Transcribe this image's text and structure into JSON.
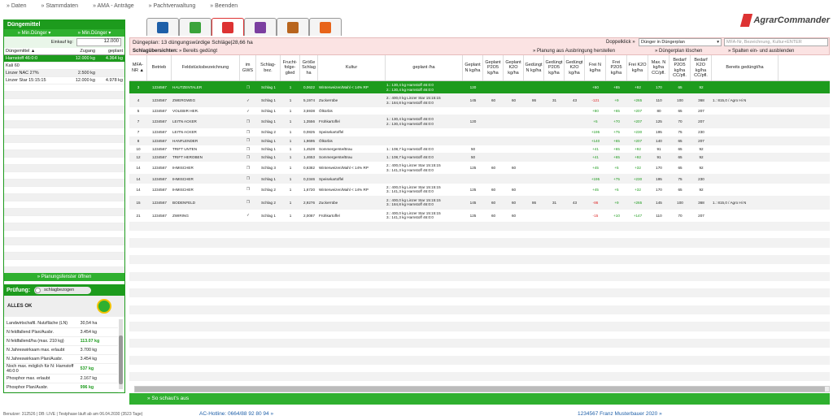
{
  "nav": [
    "» Daten",
    "» Stammdaten",
    "» AMA - Anträge",
    "» Pachtverwaltung",
    "» Beenden"
  ],
  "logo": "AgrarCommander",
  "left": {
    "title": "Düngemittel",
    "btn1": "» Min.Dünger ▾",
    "btn2": "» Min.Dünger ▾",
    "einkauf_label": "Einkauf kg:",
    "einkauf_value": "12.000",
    "cols": [
      "Düngemittel ▲",
      "Zugang",
      "geplant"
    ],
    "rows": [
      [
        "Harnstoff 46:0:0",
        "12.000 kg",
        "4.364 kg"
      ],
      [
        "Kali 60",
        "",
        ""
      ],
      [
        "Linzer NAC 27%",
        "2.500 kg",
        ""
      ],
      [
        "Linzer Star 15:15:15",
        "12.000 kg",
        "4.978 kg"
      ]
    ],
    "plan_btn": "» Planungsfenster öffnen",
    "pruef_label": "Prüfung:",
    "pruef_toggle": "schlagbezogen",
    "status": "ALLES OK",
    "checks": [
      [
        "Landwirtschaftl. Nutzfläche (LN)",
        "30,54 ha",
        ""
      ],
      [
        "N feldfallend Plan/Ausbr.",
        "3.454 kg",
        ""
      ],
      [
        "N feldfallend/ha (max. 210 kg)",
        "113.07 kg",
        "g"
      ],
      [
        "N Jahreswirksam max. erlaubt",
        "3.700 kg",
        ""
      ],
      [
        "N Jahreswirksam Plan/Ausbr.",
        "3.454 kg",
        ""
      ],
      [
        "Noch max. möglich für N: Harnstoff 46:0:0",
        "537 kg",
        "g"
      ],
      [
        "Phosphor max. erlaubt",
        "2.167 kg",
        ""
      ],
      [
        "Phosphor Plan/Ausbr.",
        "996 kg",
        "g"
      ]
    ]
  },
  "main": {
    "plan_title": "Düngeplan: 13 düngungswürdige Schläge|28,66 ha",
    "dbl_label": "Doppelklick »",
    "dbl_value": "Dünger in Düngerplan",
    "search_placeholder": "MFA-Nr, Bezeichnung, Kultur+ENTER",
    "schlag_label": "Schlagübersichten:",
    "bereits_btn": "» Bereits gedüngt",
    "planung_btn": "» Planung aus Ausbringung herstellen",
    "loeschen_btn": "» Düngerplan löschen",
    "spalten_btn": "» Spalten ein- und ausblenden",
    "so_btn": "» So schaut's aus"
  },
  "columns": [
    "MFA-NR ▲",
    "Betrieb",
    "Feldstücksbezeichnung",
    "im GWS",
    "Schlag-bez.",
    "Frucht-folge-glied",
    "Größe Schlag ha",
    "Kultur",
    "geplant /ha",
    "Geplant N kg/ha",
    "Geplant P2O5 kg/ha",
    "Geplant K2O kg/ha",
    "Gedüngt N kg/ha",
    "Gedüngt P2O5 kg/ha",
    "Gedüngt K2O kg/ha",
    "Frei N kg/ha",
    "Frei P2O5 kg/ha",
    "Frei K2O kg/ha",
    "Max. N kg/ha CC/pfl.",
    "Bedarf P2O5 kg/ha CC/pfl.",
    "Bedarf K2O kg/ha CC/pfl.",
    "Bereits gedüngt/ha"
  ],
  "rows": [
    [
      "3",
      "1234567",
      "HAUTZENTALER",
      "❐",
      "Schlag 1",
      "1",
      "0,0622",
      "Winterweizen/Mahl < 14% RP",
      "1.: 130,4 kg Harnstoff 46:0:0|2.: 130,4 kg Harnstoff 46:0:0",
      "120",
      "",
      "",
      "",
      "",
      "",
      "+50",
      "+85",
      "+92",
      "170",
      "65",
      "92",
      ""
    ],
    [
      "4",
      "1234567",
      "ZWERGWEG",
      "✓",
      "Schlag 1",
      "1",
      "5,1974",
      "Zuckerrübe",
      "2.: 400,0 kg Linzer Star 15:15:15|3.: 184,8 kg Harnstoff 46:0:0",
      "145",
      "60",
      "60",
      "86",
      "31",
      "43",
      "-121",
      "+9",
      "+265",
      "110",
      "100",
      "368",
      "1.: 815,0 / Agro Hi N"
    ],
    [
      "5",
      "1234567",
      "VOLEBIR HER.",
      "✓",
      "Schlag 1",
      "1",
      "3,5938",
      "Ölkürbis",
      "",
      "",
      "",
      "",
      "",
      "",
      "",
      "+80",
      "+65",
      "+207",
      "80",
      "65",
      "207",
      ""
    ],
    [
      "7",
      "1234567",
      "LEITN ACKER",
      "❐",
      "Schlag 1",
      "1",
      "1,3556",
      "Frühkartoffel",
      "1.: 130,4 kg Harnstoff 46:0:0|2.: 130,4 kg Harnstoff 46:0:0",
      "120",
      "",
      "",
      "",
      "",
      "",
      "+5",
      "+70",
      "+207",
      "125",
      "70",
      "207",
      ""
    ],
    [
      "7",
      "1234567",
      "LEITN ACKER",
      "❐",
      "Schlag 2",
      "1",
      "0,0825",
      "Speisekartoffel",
      "",
      "",
      "",
      "",
      "",
      "",
      "",
      "+195",
      "+75",
      "+230",
      "195",
      "75",
      "230",
      ""
    ],
    [
      "8",
      "1234567",
      "HANFLENDER",
      "❐",
      "Schlag 1",
      "1",
      "1,9695",
      "Ölkürbis",
      "",
      "",
      "",
      "",
      "",
      "",
      "",
      "+140",
      "+65",
      "+207",
      "140",
      "65",
      "207",
      ""
    ],
    [
      "10",
      "1234567",
      "TRIFT UNTEN",
      "❐",
      "Schlag 1",
      "1",
      "1,4528",
      "Sommergerste/Brau",
      "1.: 108,7 kg Harnstoff 46:0:0",
      "50",
      "",
      "",
      "",
      "",
      "",
      "+41",
      "+65",
      "+92",
      "91",
      "65",
      "92",
      ""
    ],
    [
      "12",
      "1234567",
      "TRIFT HEROBEN",
      "❐",
      "Schlag 1",
      "1",
      "1,4653",
      "Sommergerste/Brau",
      "1.: 108,7 kg Harnstoff 46:0:0",
      "50",
      "",
      "",
      "",
      "",
      "",
      "+41",
      "+65",
      "+92",
      "91",
      "65",
      "92",
      ""
    ],
    [
      "14",
      "1234567",
      "IHMISCHER",
      "❐",
      "Schlag 3",
      "1",
      "0,6382",
      "Winterweizen/Mahl < 14% RP",
      "2.: 400,0 kg Linzer Star 15:15:15|3.: 141,3 kg Harnstoff 46:0:0",
      "125",
      "60",
      "60",
      "",
      "",
      "",
      "+45",
      "+5",
      "+32",
      "170",
      "65",
      "92",
      ""
    ],
    [
      "14",
      "1234567",
      "IHMISCHER",
      "❐",
      "Schlag 1",
      "1",
      "0,2346",
      "Speisekartoffel",
      "",
      "",
      "",
      "",
      "",
      "",
      "",
      "+195",
      "+75",
      "+230",
      "195",
      "75",
      "230",
      ""
    ],
    [
      "14",
      "1234567",
      "IHMISCHER",
      "❐",
      "Schlag 2",
      "1",
      "1,6720",
      "Winterweizen/Mahl < 14% RP",
      "2.: 400,0 kg Linzer Star 15:15:15|3.: 141,3 kg Harnstoff 46:0:0",
      "125",
      "60",
      "60",
      "",
      "",
      "",
      "+45",
      "+5",
      "+32",
      "170",
      "65",
      "92",
      ""
    ],
    [
      "15",
      "1234567",
      "BODENFELD",
      "❐",
      "Schlag 2",
      "1",
      "2,9276",
      "Zuckerrübe",
      "2.: 400,0 kg Linzer Star 15:15:15|3.: 184,8 kg Harnstoff 46:0:0",
      "145",
      "60",
      "60",
      "86",
      "31",
      "43",
      "-86",
      "+9",
      "+265",
      "145",
      "100",
      "368",
      "1.: 815,0 / Agro Hi N"
    ],
    [
      "21",
      "1234567",
      "ZWIRING",
      "✓",
      "Schlag 1",
      "1",
      "2,0087",
      "Frühkartoffel",
      "2.: 400,0 kg Linzer Star 15:15:15|3.: 141,3 kg Harnstoff 46:0:0",
      "125",
      "60",
      "60",
      "",
      "",
      "",
      "-15",
      "+10",
      "+147",
      "110",
      "70",
      "207",
      ""
    ]
  ],
  "footer": {
    "user": "Benutzer: 312526 | DB: LIVE | Testphase läuft ab am 06.04.2030 (3523 Tage)",
    "hotline": "AC-Hotline: 0664/88 92 80 94 »",
    "company": "1234567 Franz Musterbauer 2020 »"
  },
  "colors": {
    "green": "#1d9b1d",
    "pink": "#fbe3e3"
  },
  "tab_icons": [
    "edit-icon",
    "list-icon",
    "chart-icon",
    "fertilizer-icon",
    "cattle-icon",
    "paragraph-icon"
  ]
}
